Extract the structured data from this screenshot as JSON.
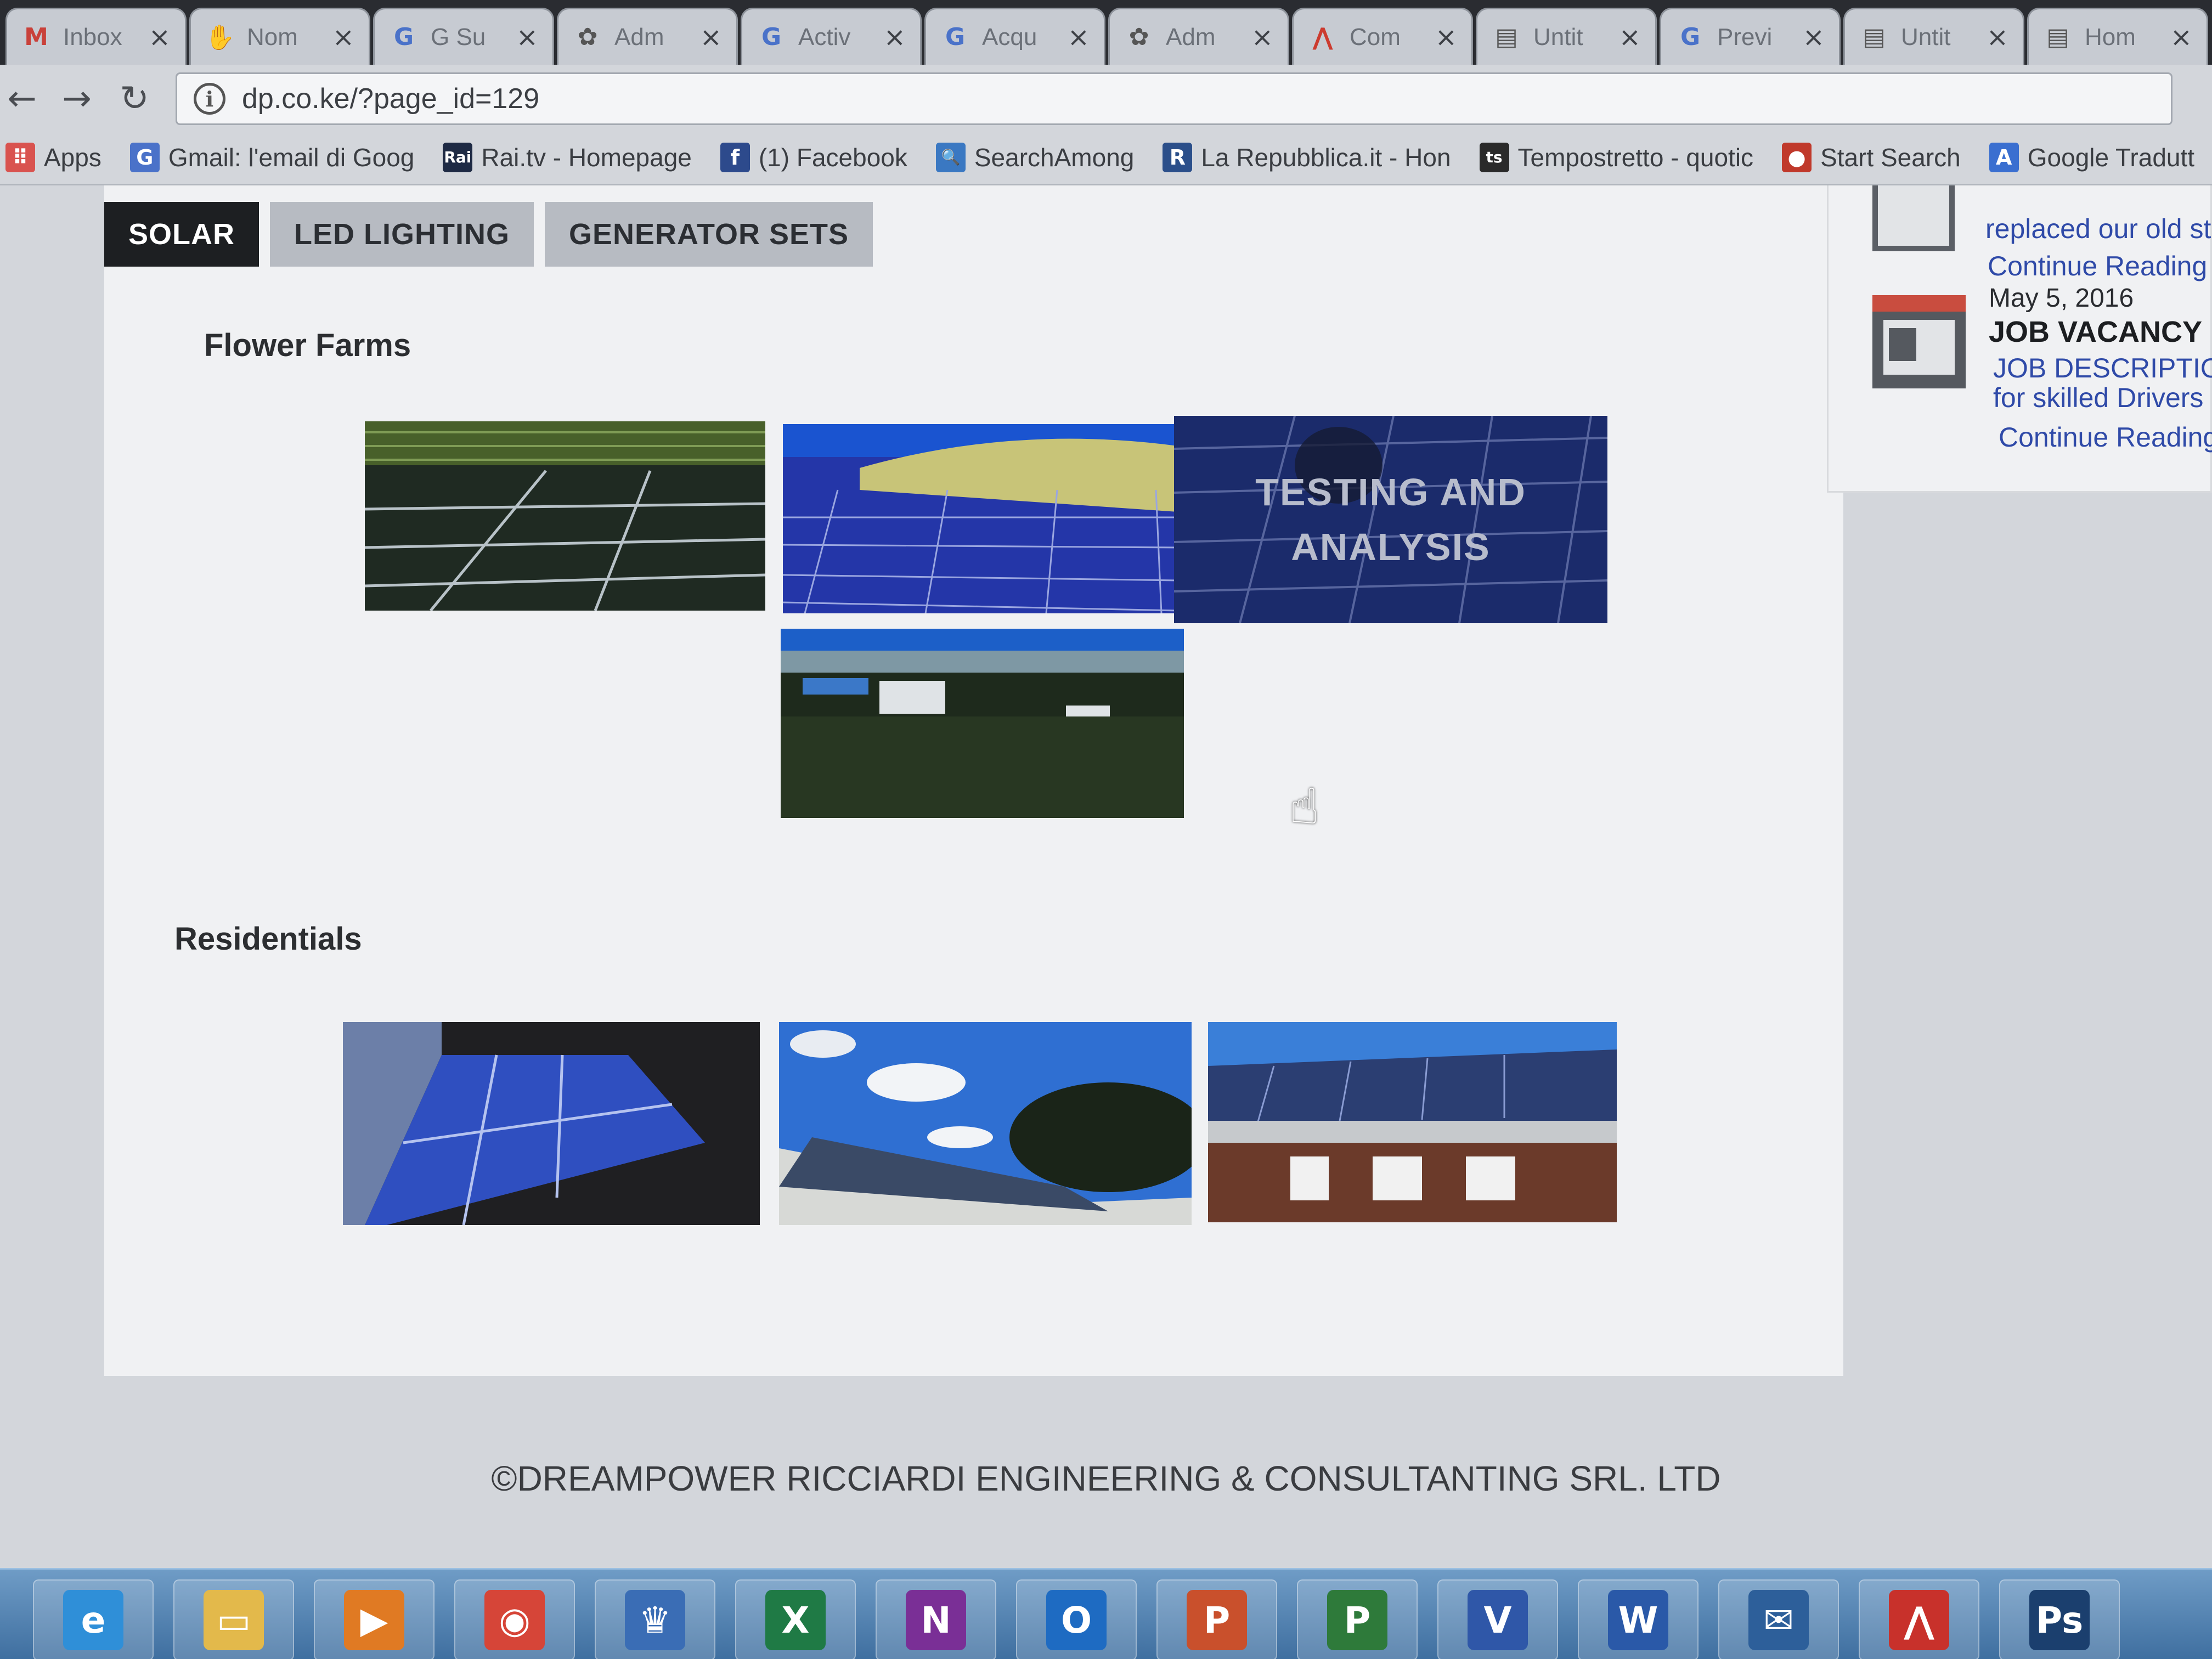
{
  "browser": {
    "tabs": [
      {
        "title": "Inbox",
        "icon": "gmail-icon",
        "glyph": "M",
        "color": "#c9413a"
      },
      {
        "title": "Nom",
        "icon": "hand-icon",
        "glyph": "✋",
        "color": "#555555"
      },
      {
        "title": "G Su",
        "icon": "google-icon",
        "glyph": "G",
        "color": "#4a72c9"
      },
      {
        "title": "Adm",
        "icon": "settings-icon",
        "glyph": "✿",
        "color": "#555555"
      },
      {
        "title": "Activ",
        "icon": "google-icon",
        "glyph": "G",
        "color": "#4a72c9"
      },
      {
        "title": "Acqu",
        "icon": "google-icon",
        "glyph": "G",
        "color": "#4a72c9"
      },
      {
        "title": "Adm",
        "icon": "settings-icon",
        "glyph": "✿",
        "color": "#555555"
      },
      {
        "title": "Com",
        "icon": "acrobat-icon",
        "glyph": "⋀",
        "color": "#cc3b2f"
      },
      {
        "title": "Untit",
        "icon": "page-icon",
        "glyph": "▤",
        "color": "#555555"
      },
      {
        "title": "Previ",
        "icon": "google-icon",
        "glyph": "G",
        "color": "#4a72c9"
      },
      {
        "title": "Untit",
        "icon": "page-icon",
        "glyph": "▤",
        "color": "#555555"
      },
      {
        "title": "Hom",
        "icon": "page-icon",
        "glyph": "▤",
        "color": "#555555"
      }
    ],
    "url": "dp.co.ke/?page_id=129",
    "bookmarks": [
      {
        "label": "Apps",
        "icon": "apps-grid-icon",
        "glyph": "⠿",
        "color": "#d9534f"
      },
      {
        "label": "Gmail: l'email di Goog",
        "icon": "google-icon",
        "glyph": "G",
        "color": "#4a72c9"
      },
      {
        "label": "Rai.tv - Homepage",
        "icon": "rai-icon",
        "glyph": "Rai",
        "color": "#1e2a44"
      },
      {
        "label": "(1) Facebook",
        "icon": "facebook-icon",
        "glyph": "f",
        "color": "#2d4a8c"
      },
      {
        "label": "SearchAmong",
        "icon": "magnifier-icon",
        "glyph": "🔍",
        "color": "#3a78c2"
      },
      {
        "label": "La Repubblica.it - Hon",
        "icon": "repubblica-icon",
        "glyph": "R",
        "color": "#2b4f8a"
      },
      {
        "label": "Tempostretto - quotic",
        "icon": "ts-icon",
        "glyph": "ts",
        "color": "#2a2a2a"
      },
      {
        "label": "Start Search",
        "icon": "speech-bubble-icon",
        "glyph": "●",
        "color": "#c0392b"
      },
      {
        "label": "Google Tradutt",
        "icon": "translate-icon",
        "glyph": "A",
        "color": "#3a6fd0"
      }
    ]
  },
  "page": {
    "tabs": [
      {
        "label": "SOLAR",
        "active": true
      },
      {
        "label": "LED LIGHTING",
        "active": false
      },
      {
        "label": "GENERATOR SETS",
        "active": false
      }
    ],
    "sections": {
      "flower_farms": "Flower Farms",
      "residentials": "Residentials"
    },
    "overlay": {
      "line1": "TESTING AND",
      "line2": "ANALYSIS"
    },
    "sidebar": {
      "snippet": "replaced our old sta",
      "continue_1": "Continue Reading -",
      "date": "May 5, 2016",
      "post_title": "JOB VACANCY",
      "desc_1": "JOB DESCRIPTIO",
      "desc_2": "for skilled Drivers",
      "continue_2": "Continue Reading"
    },
    "footer": "©DREAMPOWER RICCIARDI ENGINEERING & CONSULTANTING SRL. LTD"
  },
  "taskbar": [
    {
      "name": "internet-explorer-icon",
      "glyph": "e",
      "color": "#2f8fd8"
    },
    {
      "name": "file-explorer-icon",
      "glyph": "▭",
      "color": "#e3b94b"
    },
    {
      "name": "media-player-icon",
      "glyph": "▶",
      "color": "#e07a23"
    },
    {
      "name": "chrome-icon",
      "glyph": "◉",
      "color": "#d64538"
    },
    {
      "name": "app-store-icon",
      "glyph": "♛",
      "color": "#3a6db5"
    },
    {
      "name": "excel-icon",
      "glyph": "X",
      "color": "#1f7a45"
    },
    {
      "name": "onenote-icon",
      "glyph": "N",
      "color": "#7a2f96"
    },
    {
      "name": "outlook-icon",
      "glyph": "O",
      "color": "#1e6bc2"
    },
    {
      "name": "powerpoint-icon",
      "glyph": "P",
      "color": "#c9502c"
    },
    {
      "name": "project-icon",
      "glyph": "P",
      "color": "#2e7a3a"
    },
    {
      "name": "visio-icon",
      "glyph": "V",
      "color": "#2f57a8"
    },
    {
      "name": "word-icon",
      "glyph": "W",
      "color": "#2a59a8"
    },
    {
      "name": "thunderbird-icon",
      "glyph": "✉",
      "color": "#2d5f9a"
    },
    {
      "name": "acrobat-icon",
      "glyph": "⋀",
      "color": "#c8312b"
    },
    {
      "name": "photoshop-icon",
      "glyph": "Ps",
      "color": "#1b3f6e"
    }
  ]
}
